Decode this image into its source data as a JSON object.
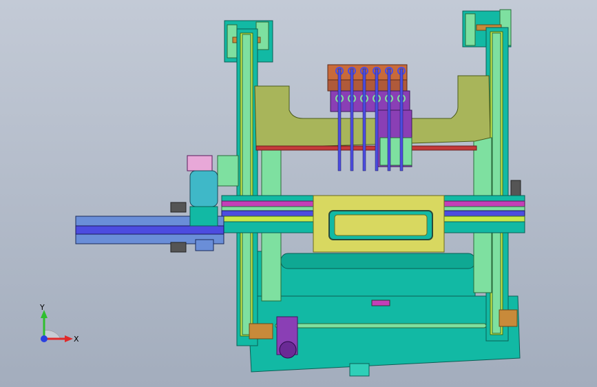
{
  "viewport": {
    "background_top": "#c3cad6",
    "background_bottom": "#a3adbd"
  },
  "model": {
    "colors": {
      "base_plate": "#12b9a4",
      "rail_green": "#7ee0a0",
      "rail_lime": "#c8e84a",
      "olive_bridge": "#a8b55a",
      "purple_block": "#8a3fb5",
      "orange_block": "#c86a3a",
      "blue_rod": "#4c4ce0",
      "yellow_slide": "#d8d860",
      "steel_blue": "#6a8ed8",
      "magenta_strip": "#c43fb8",
      "red_edge": "#c43a3a",
      "cylinder_teal": "#3fb8c8",
      "pink_block": "#e8a8d8"
    }
  },
  "triad": {
    "y_label": "Y",
    "x_label": "X",
    "y_color": "#2fbf2f",
    "x_color": "#e02a2a",
    "z_color": "#2a40e0"
  }
}
